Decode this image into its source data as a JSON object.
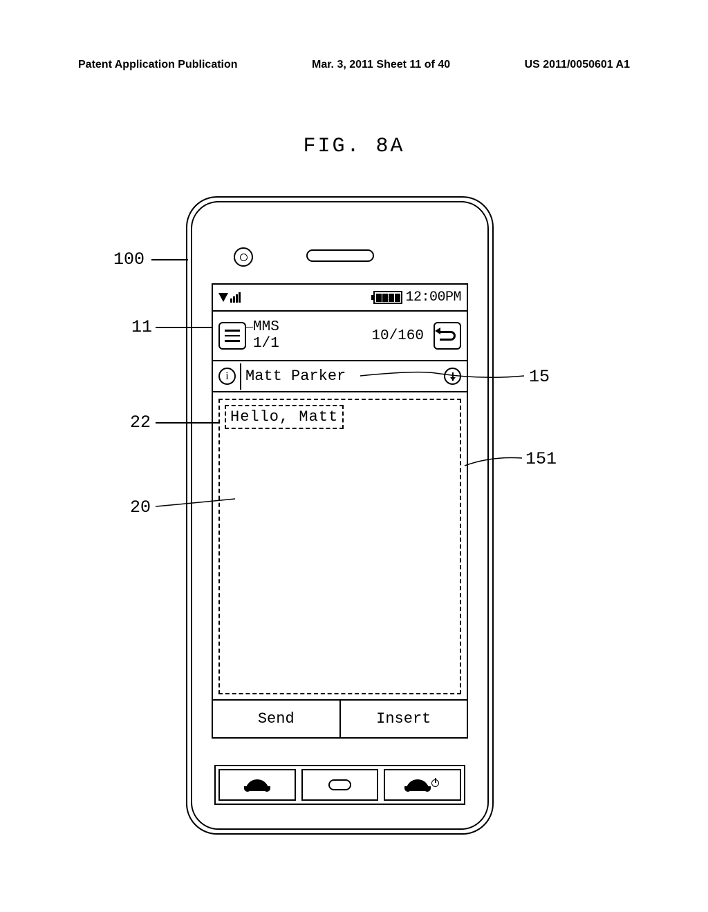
{
  "header": {
    "left": "Patent Application Publication",
    "center": "Mar. 3, 2011  Sheet 11 of 40",
    "right": "US 2011/0050601 A1"
  },
  "figure_title": "FIG. 8A",
  "status_bar": {
    "time": "12:00PM"
  },
  "title_row": {
    "line1": "MMS",
    "line2": "1/1",
    "char_count": "10/160"
  },
  "contact": {
    "name": "Matt Parker"
  },
  "message": {
    "text": "Hello, Matt"
  },
  "buttons": {
    "send": "Send",
    "insert": "Insert"
  },
  "refs": {
    "r100": "100",
    "r11": "11",
    "r22": "22",
    "r20": "20",
    "r15": "15",
    "r151": "151"
  }
}
